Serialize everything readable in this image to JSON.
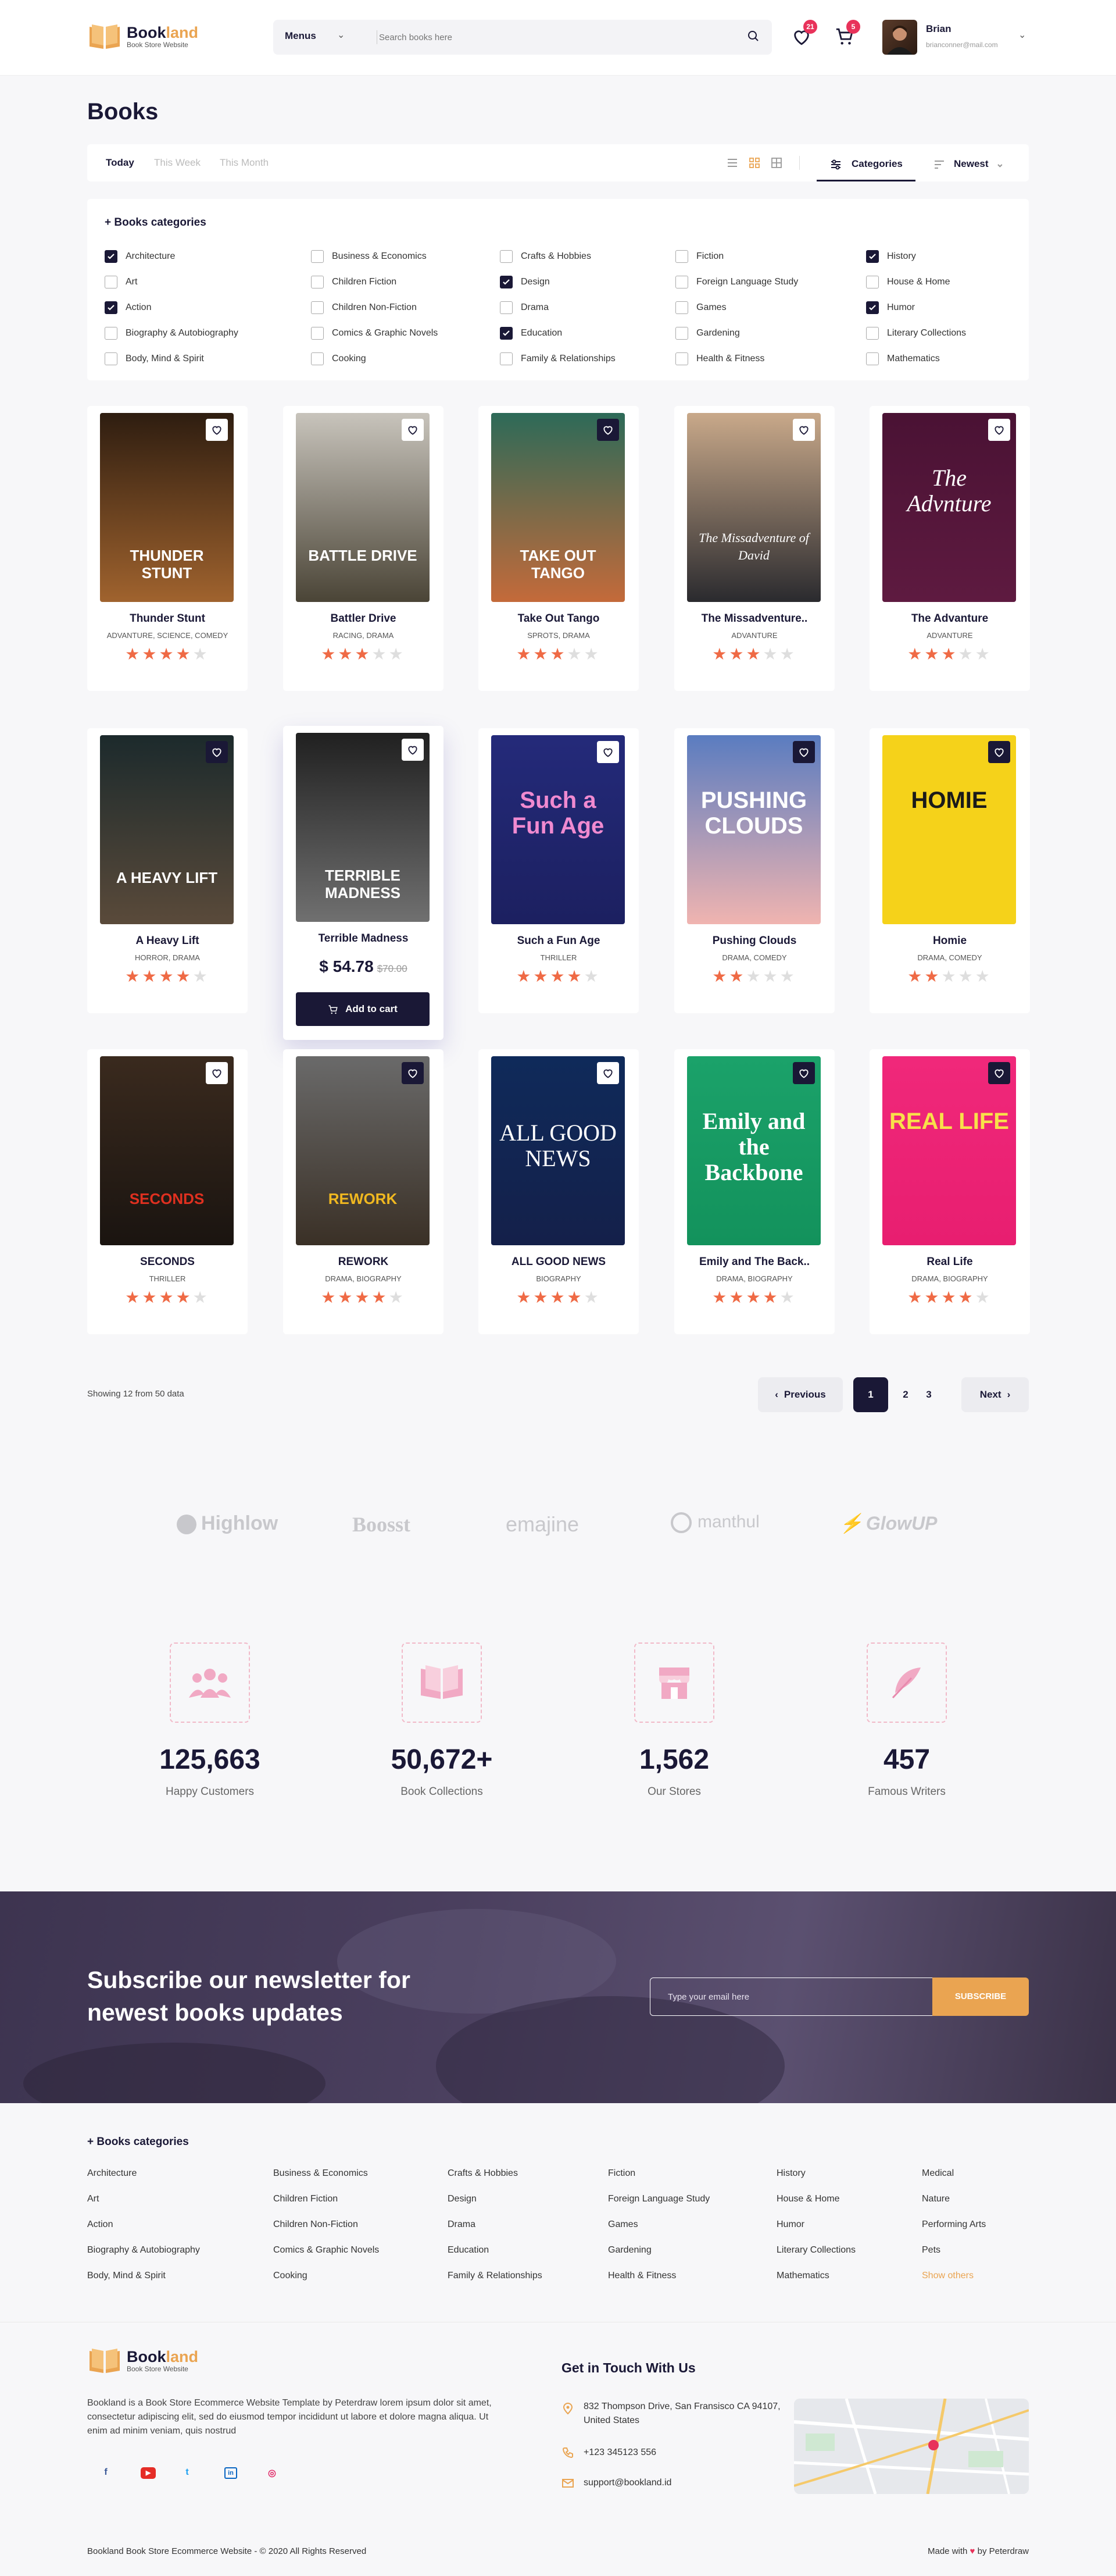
{
  "header": {
    "logo_main": "Book",
    "logo_accent": "land",
    "logo_sub": "Book Store Website",
    "menus_label": "Menus",
    "search_placeholder": "Search books here",
    "wishlist_count": "21",
    "cart_count": "5",
    "user_name": "Brian",
    "user_email": "brianconner@mail.com"
  },
  "page_title": "Books",
  "toolbar": {
    "tabs": [
      {
        "label": "Today",
        "active": true
      },
      {
        "label": "This Week",
        "active": false
      },
      {
        "label": "This Month",
        "active": false
      }
    ],
    "categories_label": "Categories",
    "sort_label": "Newest"
  },
  "categories_panel": {
    "heading": "+ Books categories",
    "columns": [
      [
        {
          "label": "Architecture",
          "checked": true
        },
        {
          "label": "Art",
          "checked": false
        },
        {
          "label": "Action",
          "checked": true
        },
        {
          "label": "Biography & Autobiography",
          "checked": false
        },
        {
          "label": "Body, Mind & Spirit",
          "checked": false
        }
      ],
      [
        {
          "label": "Business & Economics",
          "checked": false
        },
        {
          "label": "Children Fiction",
          "checked": false
        },
        {
          "label": "Children Non-Fiction",
          "checked": false
        },
        {
          "label": "Comics & Graphic Novels",
          "checked": false
        },
        {
          "label": "Cooking",
          "checked": false
        }
      ],
      [
        {
          "label": "Crafts & Hobbies",
          "checked": false
        },
        {
          "label": "Design",
          "checked": true
        },
        {
          "label": "Drama",
          "checked": false
        },
        {
          "label": "Education",
          "checked": true
        },
        {
          "label": "Family & Relationships",
          "checked": false
        }
      ],
      [
        {
          "label": "Fiction",
          "checked": false
        },
        {
          "label": "Foreign Language Study",
          "checked": false
        },
        {
          "label": "Games",
          "checked": false
        },
        {
          "label": "Gardening",
          "checked": false
        },
        {
          "label": "Health & Fitness",
          "checked": false
        }
      ],
      [
        {
          "label": "History",
          "checked": true
        },
        {
          "label": "House & Home",
          "checked": false
        },
        {
          "label": "Humor",
          "checked": true
        },
        {
          "label": "Literary Collections",
          "checked": false
        },
        {
          "label": "Mathematics",
          "checked": false
        }
      ]
    ]
  },
  "books": [
    {
      "title": "Thunder Stunt",
      "genre": "ADVANTURE, SCIENCE, COMEDY",
      "rating": 4,
      "cover_text": "THUNDER STUNT",
      "c1": "#2e1d10",
      "c2": "#a0632e",
      "text_color": "#ffffff",
      "heart_dark": false
    },
    {
      "title": "Battler Drive",
      "genre": "RACING, DRAMA",
      "rating": 3,
      "cover_text": "BATTLE DRIVE",
      "c1": "#c8c4bc",
      "c2": "#4a4436",
      "text_color": "#ffffff",
      "heart_dark": false
    },
    {
      "title": "Take Out Tango",
      "genre": "SPROTS, DRAMA",
      "rating": 3,
      "cover_text": "TAKE OUT TANGO",
      "c1": "#2d6a58",
      "c2": "#c46a3a",
      "text_color": "#ffffff",
      "heart_dark": true
    },
    {
      "title": "The Missadventure..",
      "genre": "ADVANTURE",
      "rating": 3,
      "cover_text": "The Missadventure of David",
      "c1": "#c9a98a",
      "c2": "#2a2a2e",
      "text_color": "#ffffff",
      "heart_dark": false
    },
    {
      "title": "The Advanture",
      "genre": "ADVANTURE",
      "rating": 3,
      "cover_text": "The Advnture",
      "c1": "#4a1234",
      "c2": "#5e1a40",
      "text_color": "#ffffff",
      "heart_dark": false
    },
    {
      "title": "A Heavy Lift",
      "genre": "HORROR, DRAMA",
      "rating": 4,
      "cover_text": "A HEAVY LIFT",
      "c1": "#1c2a2c",
      "c2": "#5a4a3a",
      "text_color": "#ffffff",
      "heart_dark": true
    },
    {
      "title": "Terrible Madness",
      "genre": "",
      "rating": 0,
      "cover_text": "TERRIBLE MADNESS",
      "c1": "#202020",
      "c2": "#707070",
      "text_color": "#ffffff",
      "heart_dark": false,
      "price": "$ 54.78",
      "old_price": "$70.00",
      "cart_label": "Add to cart",
      "highlight": true
    },
    {
      "title": "Such a Fun Age",
      "genre": "THRILLER",
      "rating": 4,
      "cover_text": "Such a Fun Age",
      "c1": "#242a7a",
      "c2": "#1c2060",
      "text_color": "#f08ad0",
      "heart_dark": false
    },
    {
      "title": "Pushing Clouds",
      "genre": "DRAMA, COMEDY",
      "rating": 2,
      "cover_text": "PUSHING CLOUDS",
      "c1": "#5a7cc0",
      "c2": "#f0b4b0",
      "text_color": "#ffffff",
      "heart_dark": true
    },
    {
      "title": "Homie",
      "genre": "DRAMA, COMEDY",
      "rating": 2,
      "cover_text": "HOMIE",
      "c1": "#f5d21a",
      "c2": "#f5d21a",
      "text_color": "#1a1a1a",
      "heart_dark": true
    },
    {
      "title": "SECONDS",
      "genre": "THRILLER",
      "rating": 4,
      "cover_text": "SECONDS",
      "c1": "#3a2a1e",
      "c2": "#1a1410",
      "text_color": "#e03020",
      "heart_dark": false
    },
    {
      "title": "REWORK",
      "genre": "DRAMA, BIOGRAPHY",
      "rating": 4,
      "cover_text": "REWORK",
      "c1": "#6a6a6a",
      "c2": "#3a3026",
      "text_color": "#f0b820",
      "heart_dark": true
    },
    {
      "title": "ALL GOOD NEWS",
      "genre": "BIOGRAPHY",
      "rating": 4,
      "cover_text": "ALL GOOD NEWS",
      "c1": "#0f2a5a",
      "c2": "#14204a",
      "text_color": "#ffffff",
      "heart_dark": false
    },
    {
      "title": "Emily and The Back..",
      "genre": "DRAMA, BIOGRAPHY",
      "rating": 4,
      "cover_text": "Emily and the Backbone",
      "c1": "#1ba26a",
      "c2": "#13925c",
      "text_color": "#ffffff",
      "heart_dark": true
    },
    {
      "title": "Real Life",
      "genre": "DRAMA, BIOGRAPHY",
      "rating": 4,
      "cover_text": "REAL LIFE",
      "c1": "#f0287a",
      "c2": "#e81e70",
      "text_color": "#f8e04a",
      "heart_dark": true
    }
  ],
  "pagination": {
    "showing": "Showing 12 from 50 data",
    "previous": "Previous",
    "next": "Next",
    "pages": [
      "1",
      "2",
      "3"
    ],
    "current": "1"
  },
  "brands": [
    "Highlow",
    "Boosst",
    "emajine",
    "manthul",
    "GlowUP"
  ],
  "stats": [
    {
      "value": "125,663",
      "label": "Happy Customers",
      "icon": "users-icon"
    },
    {
      "value": "50,672+",
      "label": "Book Collections",
      "icon": "book-icon"
    },
    {
      "value": "1,562",
      "label": "Our Stores",
      "icon": "store-icon"
    },
    {
      "value": "457",
      "label": "Famous Writers",
      "icon": "feather-icon"
    }
  ],
  "newsletter": {
    "title": "Subscribe our newsletter for newest books updates",
    "placeholder": "Type your email here",
    "button": "SUBSCRIBE"
  },
  "footer_categories": {
    "heading": "+ Books categories",
    "columns": [
      [
        "Architecture",
        "Art",
        "Action",
        "Biography & Autobiography",
        "Body, Mind & Spirit"
      ],
      [
        "Business & Economics",
        "Children Fiction",
        "Children Non-Fiction",
        "Comics & Graphic Novels",
        "Cooking"
      ],
      [
        "Crafts & Hobbies",
        "Design",
        "Drama",
        "Education",
        "Family & Relationships"
      ],
      [
        "Fiction",
        "Foreign Language Study",
        "Games",
        "Gardening",
        "Health & Fitness"
      ],
      [
        "History",
        "House & Home",
        "Humor",
        "Literary Collections",
        "Mathematics"
      ],
      [
        "Medical",
        "Nature",
        "Performing Arts",
        "Pets",
        "Show others"
      ]
    ]
  },
  "footer": {
    "description": "Bookland is a Book Store Ecommerce Website Template by Peterdraw lorem ipsum dolor sit amet, consectetur adipiscing elit, sed do eiusmod tempor incididunt ut labore et dolore magna aliqua. Ut enim ad minim veniam, quis nostrud",
    "socials": [
      "f",
      "▶",
      "t",
      "in",
      "◎"
    ],
    "contact_title": "Get in Touch With Us",
    "address": "832  Thompson Drive, San Fransisco CA 94107, United States",
    "phone": "+123 345123 556",
    "email": "support@bookland.id",
    "copyright": "Bookland Book Store Ecommerce Website  -   © 2020 All Rights Reserved",
    "made_pre": "Made with",
    "made_post": "by Peterdraw"
  },
  "colors": {
    "primary": "#1a1836",
    "accent": "#eaa451",
    "star": "#ef6a45",
    "badge": "#e8325a",
    "stat_icon": "#f1a9c4"
  }
}
